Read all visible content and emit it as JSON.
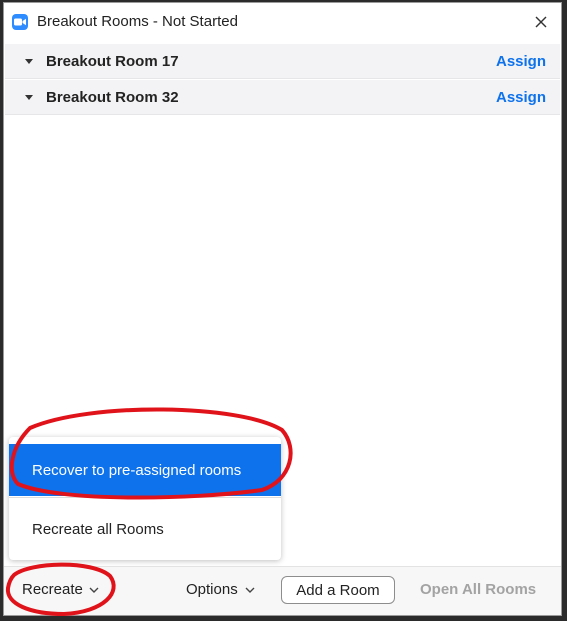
{
  "window": {
    "title": "Breakout Rooms - Not Started"
  },
  "rooms": [
    {
      "name": "Breakout Room 17",
      "action": "Assign"
    },
    {
      "name": "Breakout Room 32",
      "action": "Assign"
    }
  ],
  "dropdown": {
    "items": [
      {
        "label": "Recover to pre-assigned rooms",
        "selected": true
      },
      {
        "label": "Recreate all Rooms",
        "selected": false
      }
    ]
  },
  "footer": {
    "recreate_label": "Recreate",
    "options_label": "Options",
    "add_room_label": "Add a Room",
    "open_all_label": "Open All Rooms"
  },
  "colors": {
    "accent": "#0e72ed",
    "app_icon": "#2d8cff",
    "annotation": "#e0131b",
    "disabled_text": "#a3a3a3"
  },
  "icons": {
    "app": "video-camera-icon",
    "close": "close-icon",
    "room_caret": "caret-down-icon",
    "menu_chevron": "chevron-down-icon"
  }
}
